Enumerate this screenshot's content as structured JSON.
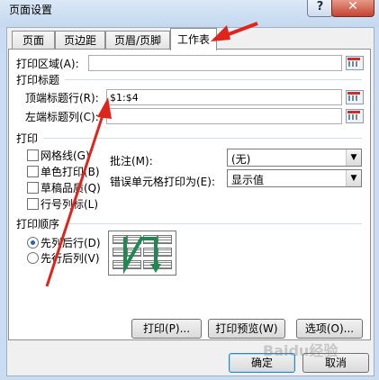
{
  "window": {
    "title": "页面设置",
    "help": "?",
    "close": "✕"
  },
  "tabs": [
    {
      "label": "页面"
    },
    {
      "label": "页边距"
    },
    {
      "label": "页眉/页脚"
    },
    {
      "label": "工作表",
      "active": true
    }
  ],
  "print_area": {
    "label": "打印区域(A):",
    "value": ""
  },
  "print_titles": {
    "section": "打印标题",
    "top_rows": {
      "label": "顶端标题行(R):",
      "value": "$1:$4"
    },
    "left_cols": {
      "label": "左端标题列(C):",
      "value": ""
    }
  },
  "print": {
    "section": "打印",
    "checkboxes": [
      {
        "label": "网格线(G)",
        "checked": false
      },
      {
        "label": "单色打印(B)",
        "checked": false
      },
      {
        "label": "草稿品质(Q)",
        "checked": false
      },
      {
        "label": "行号列标(L)",
        "checked": false
      }
    ],
    "comments": {
      "label": "批注(M):",
      "value": "(无)"
    },
    "errors": {
      "label": "错误单元格打印为(E):",
      "value": "显示值"
    }
  },
  "page_order": {
    "section": "打印顺序",
    "options": [
      {
        "label": "先列后行(D)",
        "selected": true
      },
      {
        "label": "先行后列(V)",
        "selected": false
      }
    ]
  },
  "actions": {
    "print": "打印(P)...",
    "preview": "打印预览(W)",
    "options": "选项(O)..."
  },
  "footer": {
    "ok": "确定",
    "cancel": "取消"
  },
  "watermark": "Baidu经验",
  "colors": {
    "annotation_arrow": "#e0241b",
    "selected_radio": "#2d5db2"
  }
}
